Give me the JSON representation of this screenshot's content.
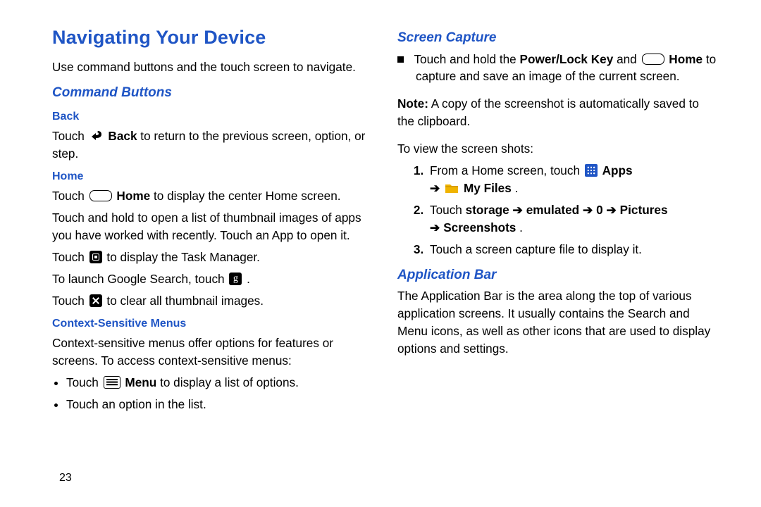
{
  "page_number": "23",
  "left": {
    "h1": "Navigating Your Device",
    "intro": "Use command buttons and the touch screen to navigate.",
    "h2_cmd": "Command Buttons",
    "back_h": "Back",
    "back_a": "Touch ",
    "back_b": " Back",
    "back_c": " to return to the previous screen, option, or step.",
    "home_h": "Home",
    "home_a": "Touch ",
    "home_b": " Home",
    "home_c": " to display the center Home screen.",
    "home_p2": "Touch and hold to open a list of thumbnail images of apps you have worked with recently. Touch an App to open it.",
    "task_a": "Touch ",
    "task_b": " to display the Task Manager.",
    "g_a": "To launch Google Search, touch ",
    "g_b": " .",
    "clear_a": "Touch ",
    "clear_b": " to clear all thumbnail images.",
    "ctx_h": "Context-Sensitive Menus",
    "ctx_p1": "Context-sensitive menus offer options for features or screens. To access context-sensitive menus:",
    "ctx_li1_a": "Touch ",
    "ctx_li1_b": " Menu",
    "ctx_li1_c": " to display a list of options.",
    "ctx_li2": "Touch an option in the list."
  },
  "right": {
    "h2_sc": "Screen Capture",
    "sc_a": "Touch and hold the ",
    "sc_b": "Power/Lock Key",
    "sc_c": " and ",
    "sc_d": " Home",
    "sc_e": " to capture and save an image of the current screen.",
    "note_label": "Note:",
    "note_text": " A copy of the screenshot is automatically saved to the clipboard.",
    "view_lead": "To view the screen shots:",
    "s1_a": "From a Home screen, touch ",
    "s1_b": " Apps",
    "s1_c_arrow": "➔ ",
    "s1_d": " My Files",
    "s1_e": ".",
    "s2_a": "Touch ",
    "s2_b": "storage",
    "s2_c": " ➔ ",
    "s2_d": "emulated",
    "s2_e": " ➔ ",
    "s2_f": "0",
    "s2_g": " ➔ ",
    "s2_h": "Pictures",
    "s2_i": " ➔ ",
    "s2_j": "Screenshots",
    "s2_k": ".",
    "s3": "Touch a screen capture file to display it.",
    "h2_app": "Application Bar",
    "app_p": "The Application Bar is the area along the top of various application screens. It usually contains the Search and Menu icons, as well as other icons that are used to display options and settings."
  }
}
